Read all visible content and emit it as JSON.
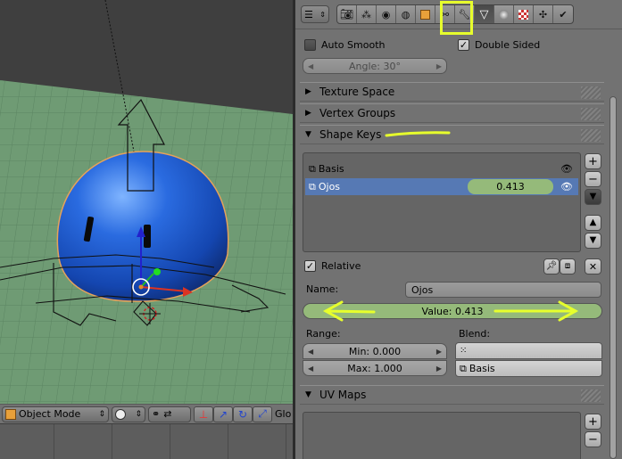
{
  "viewport": {
    "header": {
      "mode_label": "Object Mode",
      "overflow_label": "Glo"
    }
  },
  "properties": {
    "normals": {
      "auto_smooth_label": "Auto Smooth",
      "auto_smooth_checked": false,
      "double_sided_label": "Double Sided",
      "double_sided_checked": true,
      "angle_label": "Angle: 30°"
    },
    "panels": {
      "texture_space": "Texture Space",
      "vertex_groups": "Vertex Groups",
      "shape_keys": "Shape Keys",
      "uv_maps": "UV Maps"
    },
    "shape_keys": {
      "items": [
        {
          "name": "Basis",
          "value": ""
        },
        {
          "name": "Ojos",
          "value": "0.413"
        }
      ],
      "selected_index": 1,
      "relative_label": "Relative",
      "relative_checked": true,
      "name_label": "Name:",
      "name_value": "Ojos",
      "value_slider": "Value: 0.413",
      "value_fraction": 0.413,
      "range_label": "Range:",
      "min_label": "Min: 0.000",
      "max_label": "Max: 1.000",
      "blend_label": "Blend:",
      "relative_key": "Basis"
    }
  },
  "colors": {
    "highlight": "#e7ff2c",
    "selection": "#5679b4",
    "slider_fill": "#95ba7a",
    "grid_floor": "#6f9b74"
  }
}
